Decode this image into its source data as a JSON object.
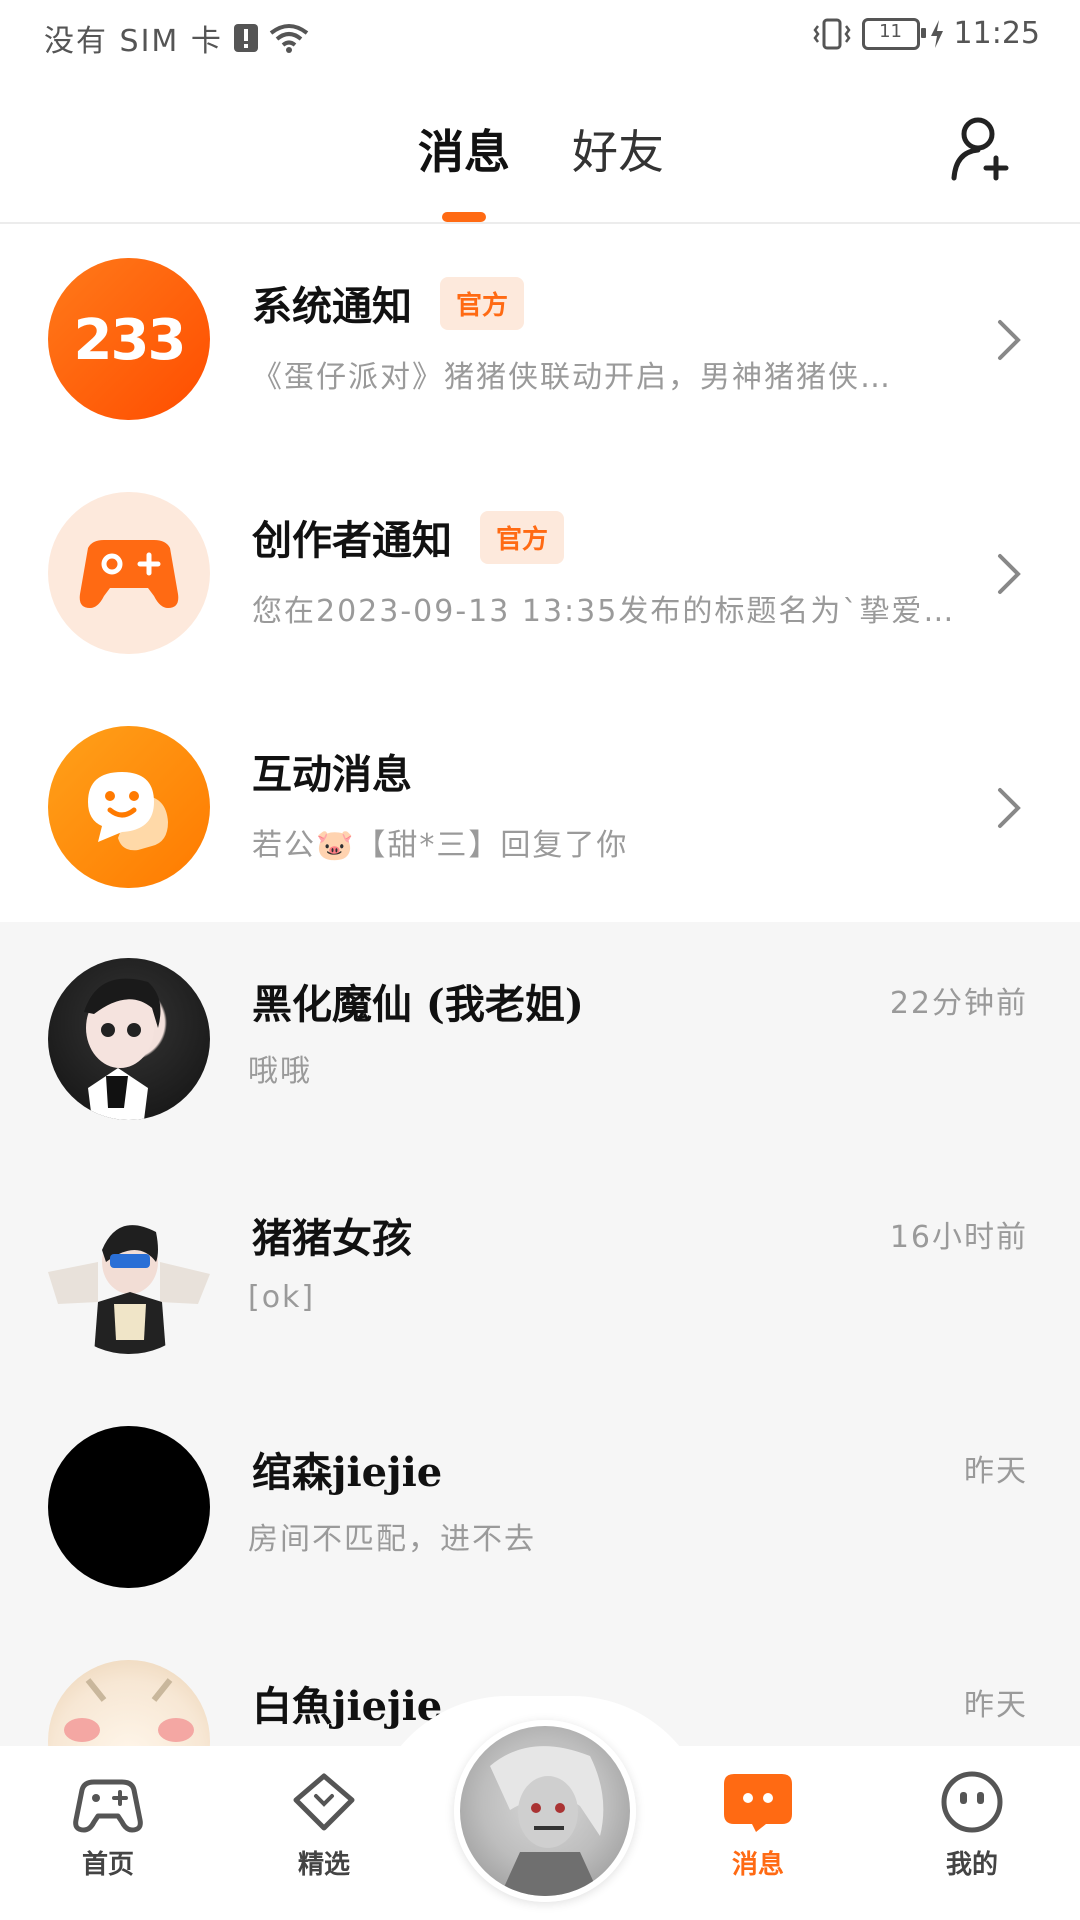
{
  "status_bar": {
    "carrier": "没有 SIM 卡",
    "battery": "11",
    "time": "11:25"
  },
  "header": {
    "tabs": [
      {
        "label": "消息",
        "active": true
      },
      {
        "label": "好友",
        "active": false
      }
    ],
    "add_friend_icon": "add-friend-icon"
  },
  "notices": [
    {
      "title": "系统通知",
      "badge": "官方",
      "subtitle": "《蛋仔派对》猪猪侠联动开启，男神猪猪侠…",
      "avatar_text": "233"
    },
    {
      "title": "创作者通知",
      "badge": "官方",
      "subtitle": "您在2023-09-13 13:35发布的标题名为`挚爱🥰`…"
    },
    {
      "title": "互动消息",
      "subtitle": "若公🐷【甜*三】回复了你"
    }
  ],
  "chats": [
    {
      "name": "黑化魔仙 (我老姐)",
      "message": "哦哦",
      "time": "22分钟前"
    },
    {
      "name": "猪猪女孩",
      "message": "[ok]",
      "time": "16小时前"
    },
    {
      "name": "绾森jiejie",
      "message": "房间不匹配，进不去",
      "time": "昨天"
    },
    {
      "name": "白魚jiejie",
      "message": "",
      "time": "昨天"
    }
  ],
  "bottom_nav": [
    {
      "label": "首页",
      "icon": "gamepad-icon"
    },
    {
      "label": "精选",
      "icon": "heart-icon"
    },
    {
      "label": "消息",
      "icon": "message-icon",
      "active": true
    },
    {
      "label": "我的",
      "icon": "smiley-icon"
    }
  ],
  "colors": {
    "accent": "#ff6a13",
    "badge_bg": "#fde9dc",
    "list_bg": "#f6f6f6"
  }
}
